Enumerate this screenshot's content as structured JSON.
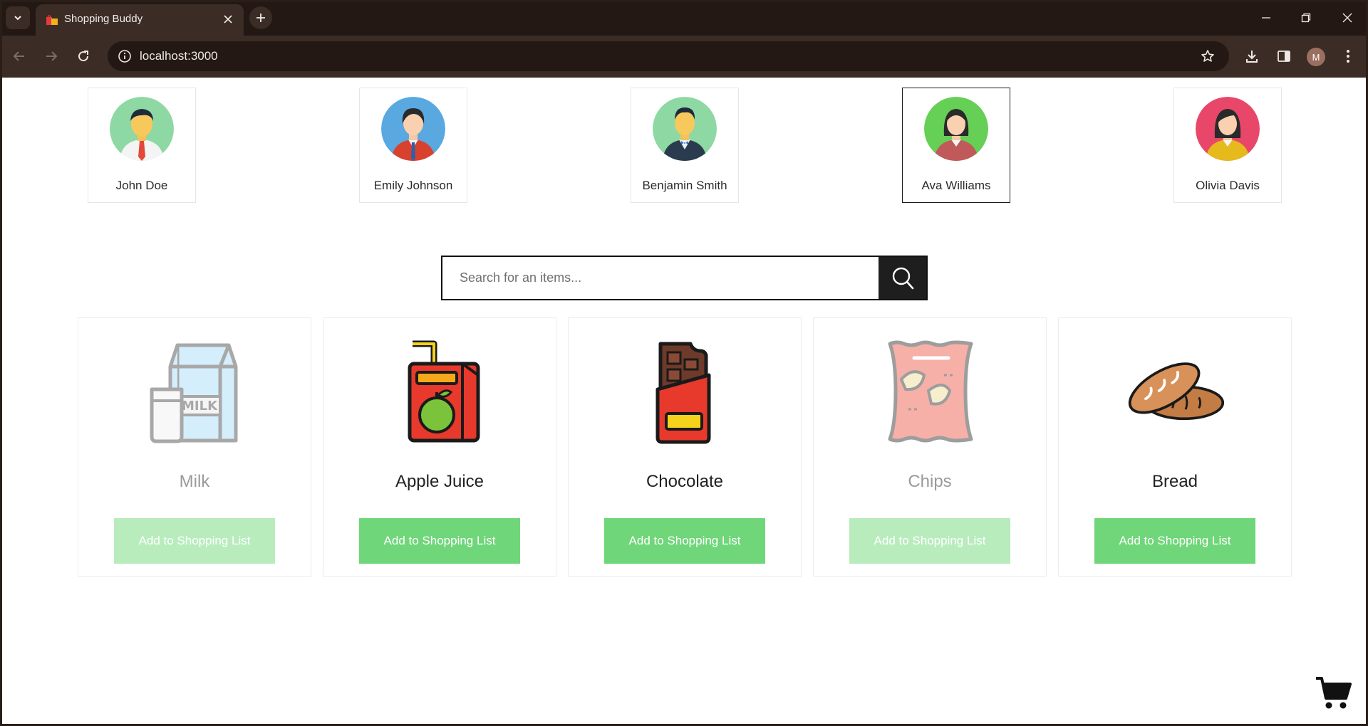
{
  "browser": {
    "tab_title": "Shopping Buddy",
    "url": "localhost:3000",
    "profile_initial": "M",
    "icons": [
      "tab-search-icon",
      "close-icon",
      "plus-icon",
      "minimize-icon",
      "restore-icon",
      "close-window-icon",
      "back-icon",
      "forward-icon",
      "reload-icon",
      "info-icon",
      "star-icon",
      "download-icon",
      "side-panel-icon",
      "menu-icon"
    ]
  },
  "users": [
    {
      "name": "John Doe",
      "selected": false,
      "bg": "#8ed8a3"
    },
    {
      "name": "Emily Johnson",
      "selected": false,
      "bg": "#5aa8e0"
    },
    {
      "name": "Benjamin Smith",
      "selected": false,
      "bg": "#8ed8a3"
    },
    {
      "name": "Ava Williams",
      "selected": true,
      "bg": "#66cf55"
    },
    {
      "name": "Olivia Davis",
      "selected": false,
      "bg": "#e8476a"
    }
  ],
  "search": {
    "placeholder": "Search for an items...",
    "value": ""
  },
  "products": [
    {
      "name": "Milk",
      "button_label": "Add to Shopping List",
      "faded": true,
      "icon": "milk-icon"
    },
    {
      "name": "Apple Juice",
      "button_label": "Add to Shopping List",
      "faded": false,
      "icon": "juice-box-icon"
    },
    {
      "name": "Chocolate",
      "button_label": "Add to Shopping List",
      "faded": false,
      "icon": "chocolate-bar-icon"
    },
    {
      "name": "Chips",
      "button_label": "Add to Shopping List",
      "faded": true,
      "icon": "chips-bag-icon"
    },
    {
      "name": "Bread",
      "button_label": "Add to Shopping List",
      "faded": false,
      "icon": "bread-icon"
    }
  ],
  "colors": {
    "button_green": "#6fd679",
    "button_green_faded": "#b8ecbd",
    "search_button": "#1e1e1e",
    "chrome_dark": "#231813",
    "chrome_mid": "#3b2c25"
  },
  "cart": {
    "icon": "shopping-cart-icon"
  }
}
